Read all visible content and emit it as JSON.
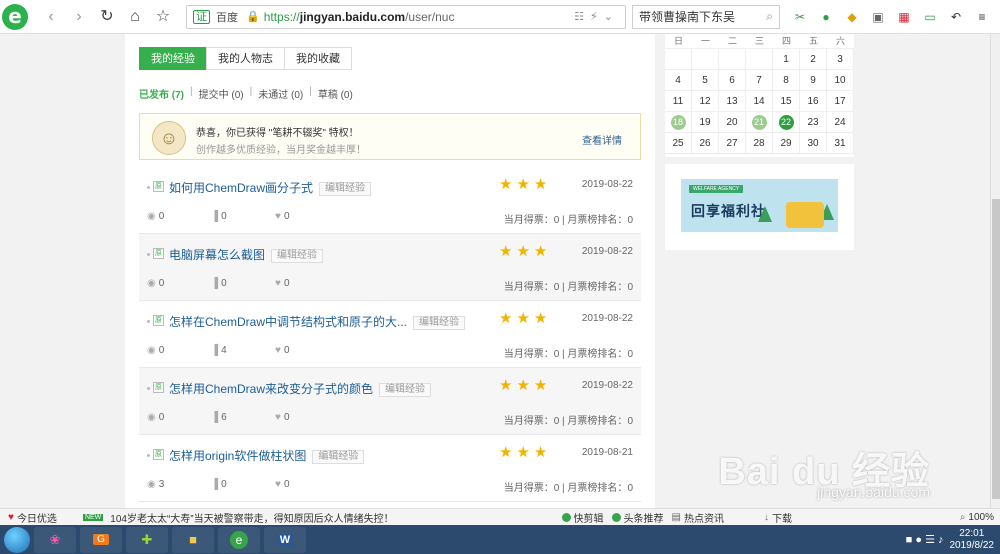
{
  "browser": {
    "site_badge": "e",
    "url_label": "百度",
    "url_prefix": "https://",
    "url_domain": "jingyan.baidu.com",
    "url_path": "/user/nuc",
    "search_text": "带领曹操南下东吴"
  },
  "tabs": [
    "我的经验",
    "我的人物志",
    "我的收藏"
  ],
  "filters": [
    {
      "label": "已发布 (7)"
    },
    {
      "label": "提交中 (0)"
    },
    {
      "label": "未通过 (0)"
    },
    {
      "label": "草稿 (0)"
    }
  ],
  "notice": {
    "line1": "恭喜，你已获得 \"笔耕不辍奖\" 特权！",
    "line2": "创作越多优质经验，当月奖金越丰厚！",
    "link": "查看详情"
  },
  "edit_label": "编辑经验",
  "rank_prefix": "当月得票：",
  "rank_mid": " | 月票榜排名：",
  "articles": [
    {
      "title": "如何用ChemDraw画分子式",
      "date": "2019-08-22",
      "views": "0",
      "votes": "0",
      "likes": "0",
      "month_votes": "0",
      "month_rank": "0",
      "rating": 3
    },
    {
      "title": "电脑屏幕怎么截图",
      "date": "2019-08-22",
      "views": "0",
      "votes": "0",
      "likes": "0",
      "month_votes": "0",
      "month_rank": "0",
      "rating": 3
    },
    {
      "title": "怎样在ChemDraw中调节结构式和原子的大...",
      "date": "2019-08-22",
      "views": "0",
      "votes": "4",
      "likes": "0",
      "month_votes": "0",
      "month_rank": "0",
      "rating": 3
    },
    {
      "title": "怎样用ChemDraw来改变分子式的颜色",
      "date": "2019-08-22",
      "views": "0",
      "votes": "6",
      "likes": "0",
      "month_votes": "0",
      "month_rank": "0",
      "rating": 3
    },
    {
      "title": "怎样用origin软件做柱状图",
      "date": "2019-08-21",
      "views": "3",
      "votes": "0",
      "likes": "0",
      "month_votes": "0",
      "month_rank": "0",
      "rating": 3
    }
  ],
  "calendar": {
    "weekdays": [
      "日",
      "一",
      "二",
      "三",
      "四",
      "五",
      "六"
    ],
    "days": [
      "",
      "",
      "",
      "",
      "1",
      "2",
      "3",
      "4",
      "5",
      "6",
      "7",
      "8",
      "9",
      "10",
      "11",
      "12",
      "13",
      "14",
      "15",
      "16",
      "17",
      "18",
      "19",
      "20",
      "21",
      "22",
      "23",
      "24",
      "25",
      "26",
      "27",
      "28",
      "29",
      "30",
      "31"
    ],
    "highlight_light": [
      "18",
      "21"
    ],
    "highlight_dark": [
      "22"
    ]
  },
  "banner": {
    "ribbon": "WELFARE AGENCY",
    "title": "回享福利社"
  },
  "statusbar": {
    "left": "今日优选",
    "news_badge": "NEW",
    "headline": "104岁老太太“大寿”当天被警察带走，得知原因后众人情绪失控！",
    "items": [
      "快剪辑",
      "头条推荐",
      "热点资讯",
      "下载",
      "100%"
    ]
  },
  "taskbar": {
    "time": "22:01",
    "date": "2019/8/22"
  },
  "watermark": {
    "main": "Bai du 经验",
    "sub": "jingyan.baidu.com"
  },
  "colors": {
    "accent": "#36b04c",
    "link": "#1d5e97",
    "star": "#f2b400"
  }
}
